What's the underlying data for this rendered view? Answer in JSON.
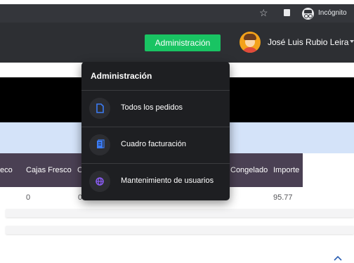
{
  "browser": {
    "star_glyph": "☆",
    "incognito_label": "Incógnito"
  },
  "header": {
    "admin_button": "Administración",
    "user_name": "José Luis Rubio Leira"
  },
  "table": {
    "headers": [
      "eco",
      "Cajas Fresco",
      "C",
      "Congelado",
      "Importe"
    ],
    "row": [
      "0",
      "0",
      "95.77"
    ]
  },
  "menu": {
    "title": "Administración",
    "items": [
      {
        "label": "Todos los pedidos",
        "icon": "document-icon"
      },
      {
        "label": "Cuadro facturación",
        "icon": "invoice-icon"
      },
      {
        "label": "Mantenimiento de usuarios",
        "icon": "globe-icon"
      }
    ]
  },
  "colors": {
    "admin_button_bg": "#19c463",
    "table_header_bg": "#4a4053",
    "menu_bg": "#1e1f22",
    "icon_accent": "#3b7bf3",
    "globe_accent": "#8b5cf6"
  }
}
